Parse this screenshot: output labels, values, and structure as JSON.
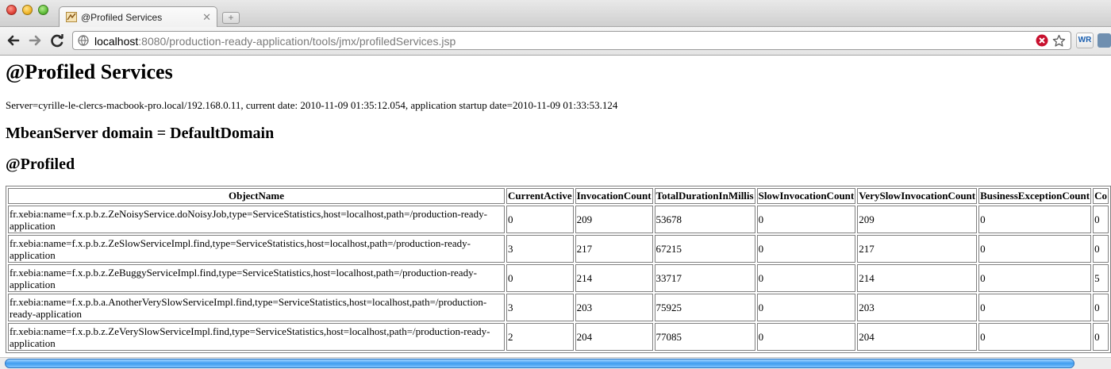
{
  "browser": {
    "tab_title": "@Profiled Services",
    "url_host": "localhost",
    "url_rest": ":8080/production-ready-application/tools/jmx/profiledServices.jsp",
    "ext_label": "WR"
  },
  "page": {
    "title": "@Profiled Services",
    "server_info": "Server=cyrille-le-clercs-macbook-pro.local/192.168.0.11, current date: 2010-11-09 01:35:12.054, application startup date=2010-11-09 01:33:53.124",
    "domain_heading": "MbeanServer domain = DefaultDomain",
    "section_heading": "@Profiled"
  },
  "table": {
    "columns": [
      "ObjectName",
      "CurrentActive",
      "InvocationCount",
      "TotalDurationInMillis",
      "SlowInvocationCount",
      "VerySlowInvocationCount",
      "BusinessExceptionCount",
      "Co"
    ],
    "rows": [
      [
        "fr.xebia:name=f.x.p.b.z.ZeNoisyService.doNoisyJob,type=ServiceStatistics,host=localhost,path=/production-ready-application",
        "0",
        "209",
        "53678",
        "0",
        "209",
        "0",
        "0"
      ],
      [
        "fr.xebia:name=f.x.p.b.z.ZeSlowServiceImpl.find,type=ServiceStatistics,host=localhost,path=/production-ready-application",
        "3",
        "217",
        "67215",
        "0",
        "217",
        "0",
        "0"
      ],
      [
        "fr.xebia:name=f.x.p.b.z.ZeBuggyServiceImpl.find,type=ServiceStatistics,host=localhost,path=/production-ready-application",
        "0",
        "214",
        "33717",
        "0",
        "214",
        "0",
        "5"
      ],
      [
        "fr.xebia:name=f.x.p.b.a.AnotherVerySlowServiceImpl.find,type=ServiceStatistics,host=localhost,path=/production-ready-application",
        "3",
        "203",
        "75925",
        "0",
        "203",
        "0",
        "0"
      ],
      [
        "fr.xebia:name=f.x.p.b.z.ZeVerySlowServiceImpl.find,type=ServiceStatistics,host=localhost,path=/production-ready-application",
        "2",
        "204",
        "77085",
        "0",
        "204",
        "0",
        "0"
      ]
    ]
  }
}
